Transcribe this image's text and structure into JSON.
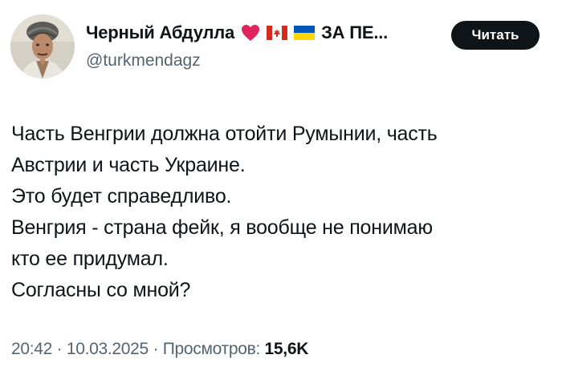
{
  "author": {
    "display_name": "Черный Абдулла",
    "name_suffix": "ЗА ПЕ...",
    "name_emojis": [
      "red-heart-emoji",
      "canada-flag-emoji",
      "ukraine-flag-emoji"
    ],
    "handle": "@turkmendagz"
  },
  "follow_button": {
    "label": "Читать"
  },
  "tweet": {
    "lines": [
      "Часть Венгрии должна отойти Румынии, часть",
      "Австрии и часть Украине.",
      "Это будет справедливо.",
      "Венгрия - страна фейк, я вообще не понимаю",
      "кто ее придумал.",
      "Согласны со мной?"
    ]
  },
  "meta": {
    "time": "20:42",
    "separator": " · ",
    "date": "10.03.2025",
    "views_label": "Просмотров:",
    "views_count": "15,6K"
  },
  "colors": {
    "text": "#0f1419",
    "secondary": "#536471",
    "button_bg": "#0f1419",
    "heart": "#e0245e",
    "canada_red": "#d52b1e",
    "ukraine_blue": "#0057b7",
    "ukraine_yellow": "#ffd700"
  }
}
